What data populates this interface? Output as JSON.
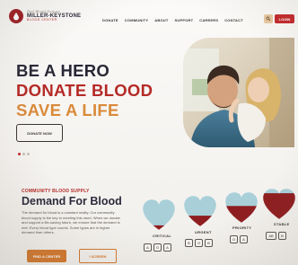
{
  "logo": {
    "tagline": "Red Blood Donors",
    "name": "MILLER-KEYSTONE",
    "sub": "BLOOD CENTER"
  },
  "nav": {
    "items": [
      "DONATE",
      "COMMUNITY",
      "ABOUT",
      "SUPPORT",
      "CAREERS",
      "CONTACT"
    ],
    "login": "LOGIN"
  },
  "icons": {
    "search": "search-icon",
    "heart": "heart-icon"
  },
  "hero": {
    "line1": "BE A HERO",
    "line2": "DONATE BLOOD",
    "line3": "SAVE A LIFE",
    "cta": "DONATE NOW",
    "slides": 3,
    "active_slide": 0
  },
  "supply": {
    "kicker": "COMMUNITY BLOOD SUPPLY",
    "title": "Demand For Blood",
    "body": "The demand for blood is a constant reality. Our community blood supply is the key to meeting this need. When we donate and support a life-saving future, we ensure that the demand is met. Every blood type counts. Some types are in higher demand than others.",
    "find_center": "FIND A CENTER",
    "screen": "I SCREEN",
    "levels": [
      {
        "label": "CRITICAL",
        "fill": 0.15,
        "types": [
          "A",
          "O",
          "A"
        ]
      },
      {
        "label": "URGENT",
        "fill": 0.35,
        "types": [
          "B",
          "O",
          "B"
        ]
      },
      {
        "label": "PRIORITY",
        "fill": 0.55,
        "types": [
          "O",
          "A"
        ]
      },
      {
        "label": "STABLE",
        "fill": 0.85,
        "types": [
          "AB",
          "B"
        ]
      }
    ]
  },
  "colors": {
    "brand_red": "#b52a26",
    "accent_orange": "#d2772c",
    "dark_navy": "#282735",
    "heart_empty": "#a9cfd8"
  }
}
